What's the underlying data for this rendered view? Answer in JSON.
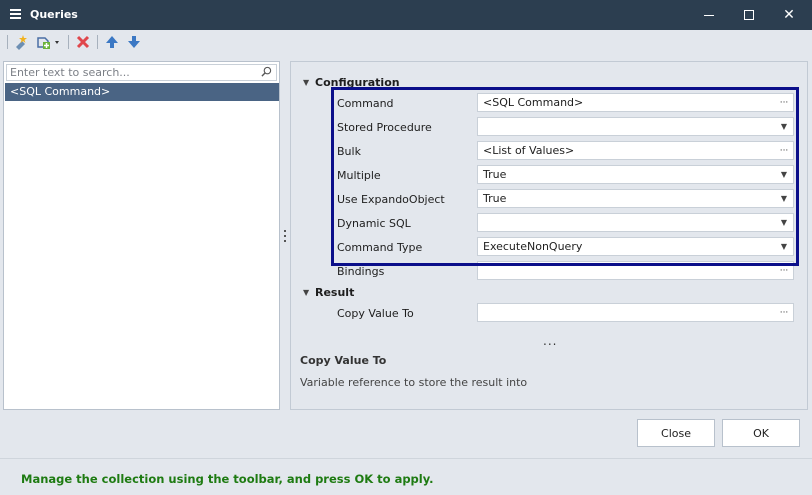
{
  "window": {
    "title": "Queries",
    "icons": {
      "app": "list-icon",
      "minimize": "minimize-icon",
      "maximize": "maximize-icon",
      "close": "close-icon"
    }
  },
  "toolbar": {
    "buttons": [
      {
        "name": "add-new",
        "icon": "new-item-icon"
      },
      {
        "name": "add-type",
        "icon": "add-type-icon"
      },
      {
        "name": "delete",
        "icon": "delete-icon"
      },
      {
        "name": "move-up",
        "icon": "arrow-up-icon"
      },
      {
        "name": "move-down",
        "icon": "arrow-down-icon"
      }
    ]
  },
  "left": {
    "search_placeholder": "Enter text to search...",
    "items": [
      "<SQL Command>"
    ]
  },
  "grid": {
    "categories": {
      "configuration": "Configuration",
      "result": "Result"
    },
    "rows": [
      {
        "label": "Command",
        "value": "<SQL Command>",
        "editor": "ellipsis"
      },
      {
        "label": "Stored Procedure",
        "value": "",
        "editor": "dropdown"
      },
      {
        "label": "Bulk",
        "value": "<List of Values>",
        "editor": "ellipsis"
      },
      {
        "label": "Multiple",
        "value": "True",
        "editor": "dropdown"
      },
      {
        "label": "Use ExpandoObject",
        "value": "True",
        "editor": "dropdown"
      },
      {
        "label": "Dynamic SQL",
        "value": "",
        "editor": "dropdown"
      },
      {
        "label": "Command Type",
        "value": "ExecuteNonQuery",
        "editor": "dropdown"
      },
      {
        "label": "Bindings",
        "value": "",
        "editor": "ellipsis"
      }
    ],
    "result_rows": [
      {
        "label": "Copy Value To",
        "value": "",
        "editor": "ellipsis"
      }
    ],
    "more": "...",
    "description": {
      "title": "Copy Value To",
      "text": "Variable reference to store the result into"
    },
    "highlight_color": "#0b0f8a"
  },
  "buttons": {
    "close": "Close",
    "ok": "OK"
  },
  "status": {
    "message": "Manage the collection using the toolbar, and press OK to apply.",
    "color": "#1e7b12"
  },
  "colors": {
    "titlebar": "#2c3e50",
    "selection": "#4a6484",
    "background": "#e3e7ed"
  }
}
